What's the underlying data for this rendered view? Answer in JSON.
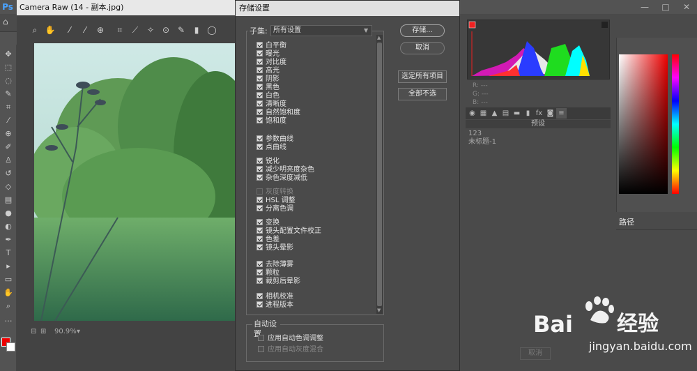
{
  "photoshop": {
    "logo": "Ps",
    "window_controls": [
      "—",
      "□",
      "✕"
    ]
  },
  "camera_raw": {
    "title": "Camera Raw (14 - 副本.jpg)",
    "zoom": "90.9%"
  },
  "dialog": {
    "title": "存储设置",
    "subset_label": "子集:",
    "subset_value": "所有设置",
    "buttons": {
      "save": "存储...",
      "cancel": "取消",
      "select_all": "选定所有项目",
      "select_none": "全部不选"
    },
    "items": [
      {
        "label": "白平衡",
        "checked": true
      },
      {
        "label": "曝光",
        "checked": true
      },
      {
        "label": "对比度",
        "checked": true
      },
      {
        "label": "高光",
        "checked": true
      },
      {
        "label": "阴影",
        "checked": true
      },
      {
        "label": "黑色",
        "checked": true
      },
      {
        "label": "白色",
        "checked": true
      },
      {
        "label": "清晰度",
        "checked": true
      },
      {
        "label": "自然饱和度",
        "checked": true
      },
      {
        "label": "饱和度",
        "checked": true
      },
      {
        "label": "参数曲线",
        "checked": true
      },
      {
        "label": "点曲线",
        "checked": true
      },
      {
        "label": "锐化",
        "checked": true
      },
      {
        "label": "减少明亮度杂色",
        "checked": true
      },
      {
        "label": "杂色深度减低",
        "checked": true
      },
      {
        "label": "灰度转换",
        "checked": false
      },
      {
        "label": "HSL 调整",
        "checked": true
      },
      {
        "label": "分离色调",
        "checked": true
      },
      {
        "label": "变换",
        "checked": true
      },
      {
        "label": "镜头配置文件校正",
        "checked": true
      },
      {
        "label": "色差",
        "checked": true
      },
      {
        "label": "镜头晕影",
        "checked": true
      },
      {
        "label": "去除薄雾",
        "checked": true
      },
      {
        "label": "颗粒",
        "checked": true
      },
      {
        "label": "裁剪后晕影",
        "checked": true
      },
      {
        "label": "相机校准",
        "checked": true
      },
      {
        "label": "进程版本",
        "checked": true
      }
    ],
    "auto_settings": {
      "label": "自动设置",
      "items": [
        {
          "label": "应用自动色调调整",
          "checked": false
        },
        {
          "label": "应用自动灰度混合",
          "checked": false,
          "disabled": true
        }
      ]
    }
  },
  "right_panel": {
    "rgb_readout": [
      "R:  ---",
      "G:  ---",
      "B:  ---"
    ],
    "presets_header": "预设",
    "presets": [
      "123",
      "未标题-1"
    ],
    "paths_tab": "路径",
    "cancel_ghost": "取消"
  },
  "watermark": {
    "brand": "Bai",
    "brand_suffix": "经验",
    "url": "jingyan.baidu.com"
  },
  "colors": {
    "foreground": "#e00000",
    "background": "#ffffff",
    "accent": "#4aa3ff"
  }
}
